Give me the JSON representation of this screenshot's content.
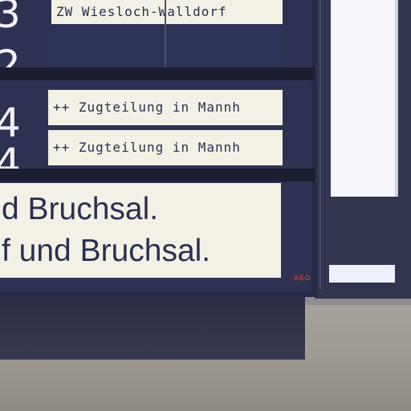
{
  "board": {
    "track_rows": [
      {
        "track": "3",
        "info": "ZW Wiesloch-Walldorf"
      },
      {
        "track": "2",
        "info": ""
      },
      {
        "track": "4",
        "info": "++ Zugteilung in Mannh"
      },
      {
        "track": "4",
        "info": "++ Zugteilung in Mannh"
      }
    ],
    "ticker_lines": [
      "d Bruchsal.",
      "f und Bruchsal."
    ],
    "manufacturer_logo": "AEG"
  },
  "colors": {
    "housing": "#272a45",
    "lcd_background": "#f3f0e6",
    "lcd_text": "#2a2f4f",
    "logo": "#c0392b"
  }
}
